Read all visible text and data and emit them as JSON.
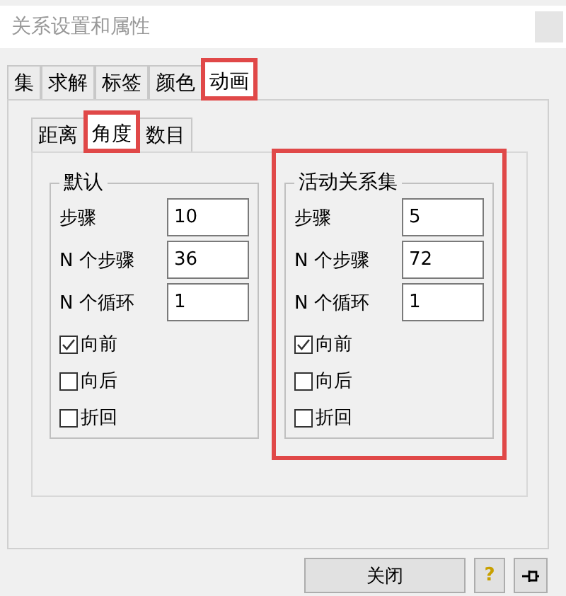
{
  "window": {
    "title": "关系设置和属性"
  },
  "tabs": [
    {
      "label": "集",
      "selected": false,
      "highlighted": false
    },
    {
      "label": "求解",
      "selected": false,
      "highlighted": false
    },
    {
      "label": "标签",
      "selected": false,
      "highlighted": false
    },
    {
      "label": "颜色",
      "selected": false,
      "highlighted": false
    },
    {
      "label": "动画",
      "selected": true,
      "highlighted": true
    }
  ],
  "subtabs": [
    {
      "label": "距离",
      "selected": false,
      "highlighted": false
    },
    {
      "label": "角度",
      "selected": true,
      "highlighted": true
    },
    {
      "label": "数目",
      "selected": false,
      "highlighted": false
    }
  ],
  "groups": [
    {
      "title": "默认",
      "highlighted": false,
      "fields": [
        {
          "label": "步骤",
          "value": "10"
        },
        {
          "label": "N 个步骤",
          "value": "36"
        },
        {
          "label": "N 个循环",
          "value": "1"
        }
      ],
      "checkboxes": [
        {
          "label": "向前",
          "checked": true
        },
        {
          "label": "向后",
          "checked": false
        },
        {
          "label": "折回",
          "checked": false
        }
      ]
    },
    {
      "title": "活动关系集",
      "highlighted": true,
      "fields": [
        {
          "label": "步骤",
          "value": "5"
        },
        {
          "label": "N 个步骤",
          "value": "72"
        },
        {
          "label": "N 个循环",
          "value": "1"
        }
      ],
      "checkboxes": [
        {
          "label": "向前",
          "checked": true
        },
        {
          "label": "向后",
          "checked": false
        },
        {
          "label": "折回",
          "checked": false
        }
      ]
    }
  ],
  "buttons": {
    "close": "关闭",
    "help": "?"
  }
}
